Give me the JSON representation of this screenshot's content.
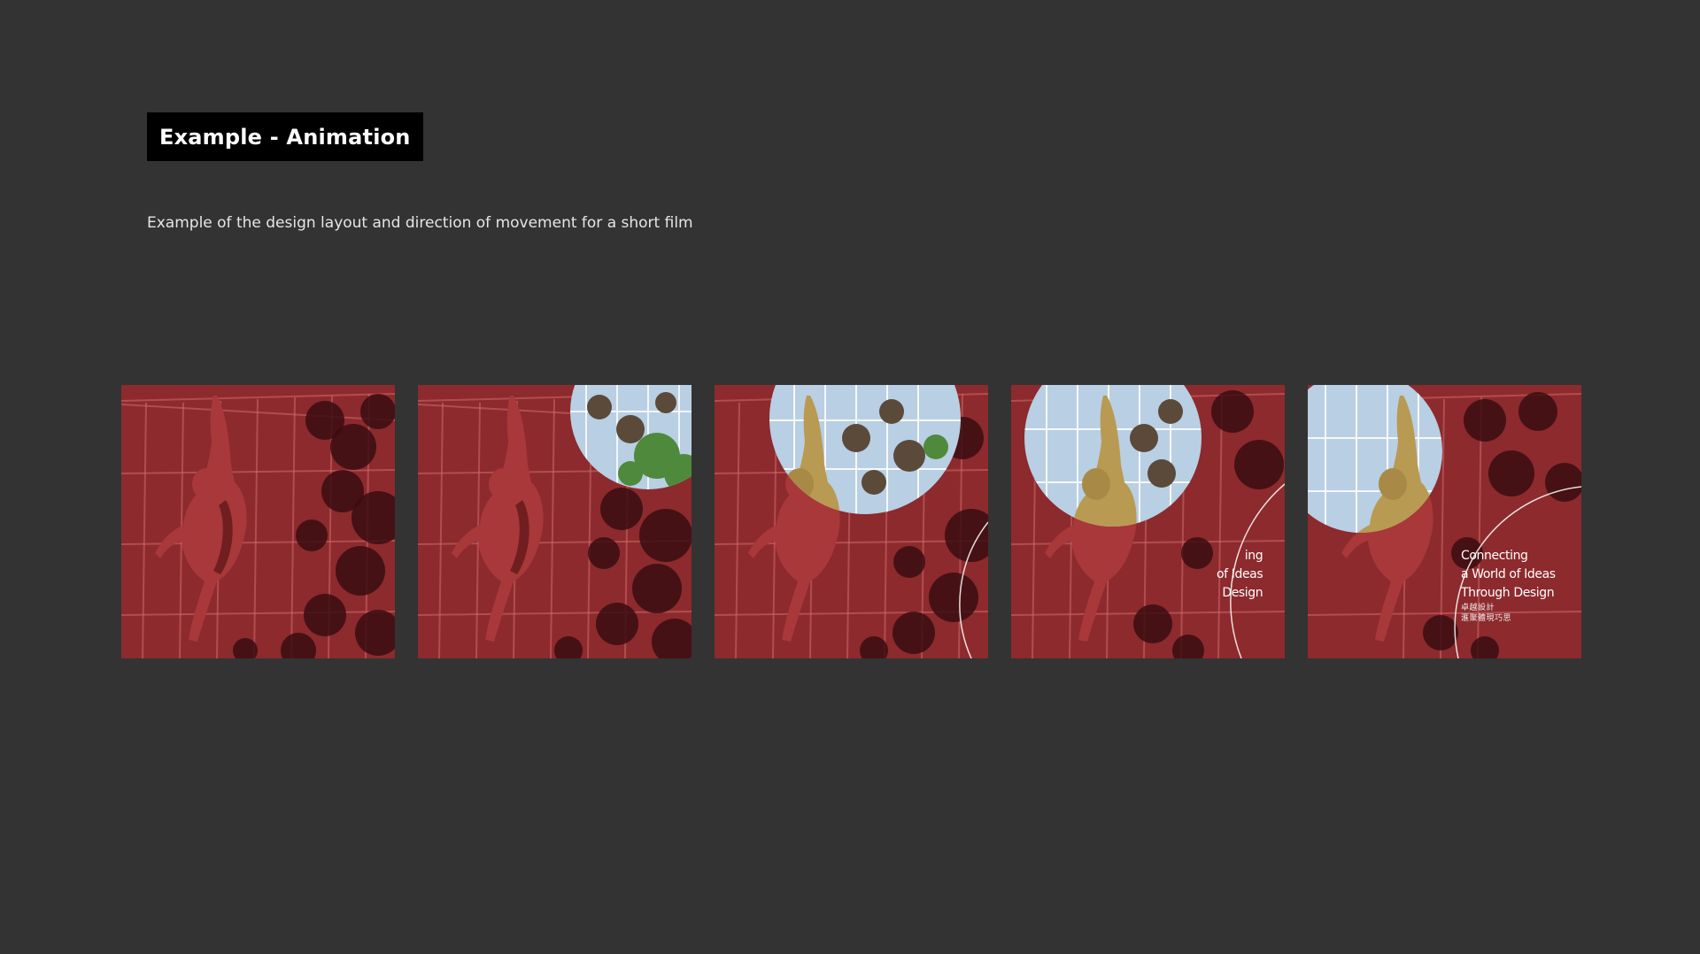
{
  "header": {
    "title": "Example - Animation",
    "subtitle": "Example of the design layout and direction of movement for a short film"
  },
  "frames": {
    "count": 5,
    "frame4_copy": [
      "ing",
      "of Ideas",
      "Design"
    ],
    "frame5_copy": [
      "Connecting",
      "a World of Ideas",
      "Through Design"
    ],
    "frame5_copy_zh": [
      "卓越設計",
      "滙聚體現巧思"
    ]
  },
  "colors": {
    "background": "#333333",
    "title_box": "#000000",
    "red_overlay": "#c0383c",
    "sky": "#b9cfe3",
    "gold_figure": "#b99a52"
  }
}
